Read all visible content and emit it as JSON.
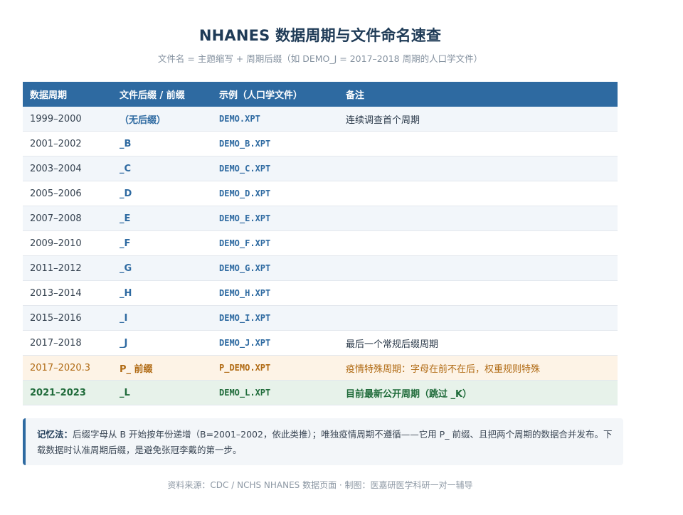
{
  "header": {
    "title": "NHANES 数据周期与文件命名速查",
    "subtitle": "文件名 = 主题缩写 + 周期后缀（如 DEMO_J = 2017–2018 周期的人口学文件）"
  },
  "table": {
    "columns": [
      "数据周期",
      "文件后缀 / 前缀",
      "示例（人口学文件）",
      "备注"
    ],
    "rows": [
      {
        "period": "1999–2000",
        "suffix": "（无后缀）",
        "file": "DEMO.XPT",
        "note": "连续调查首个周期"
      },
      {
        "period": "2001–2002",
        "suffix": "_B",
        "file": "DEMO_B.XPT",
        "note": ""
      },
      {
        "period": "2003–2004",
        "suffix": "_C",
        "file": "DEMO_C.XPT",
        "note": ""
      },
      {
        "period": "2005–2006",
        "suffix": "_D",
        "file": "DEMO_D.XPT",
        "note": ""
      },
      {
        "period": "2007–2008",
        "suffix": "_E",
        "file": "DEMO_E.XPT",
        "note": ""
      },
      {
        "period": "2009–2010",
        "suffix": "_F",
        "file": "DEMO_F.XPT",
        "note": ""
      },
      {
        "period": "2011–2012",
        "suffix": "_G",
        "file": "DEMO_G.XPT",
        "note": ""
      },
      {
        "period": "2013–2014",
        "suffix": "_H",
        "file": "DEMO_H.XPT",
        "note": ""
      },
      {
        "period": "2015–2016",
        "suffix": "_I",
        "file": "DEMO_I.XPT",
        "note": ""
      },
      {
        "period": "2017–2018",
        "suffix": "_J",
        "file": "DEMO_J.XPT",
        "note": "最后一个常规后缀周期"
      },
      {
        "period": "2017–2020.3",
        "suffix": "P_ 前缀",
        "file": "P_DEMO.XPT",
        "note": "疫情特殊周期：字母在前不在后，权重规则特殊"
      },
      {
        "period": "2021–2023",
        "suffix": "_L",
        "file": "DEMO_L.XPT",
        "note": "目前最新公开周期（跳过 _K）"
      }
    ]
  },
  "mnemonic": {
    "label": "记忆法：",
    "text": "后缀字母从 B 开始按年份递增（B=2001–2002，依此类推）；唯独疫情周期不遵循——它用 P_ 前缀、且把两个周期的数据合并发布。下载数据时认准周期后缀，是避免张冠李戴的第一步。"
  },
  "footer": {
    "text": "资料来源：CDC / NCHS NHANES 数据页面 · 制图：医嘉研医学科研一对一辅导"
  },
  "colors": {
    "header_bg": "#2e6aa1",
    "accent_blue": "#2e6aa1",
    "pandemic_text": "#b06a13",
    "pandemic_bg": "#fdf3e6",
    "latest_text": "#1f6b3a",
    "latest_bg": "#e7f2ea"
  }
}
